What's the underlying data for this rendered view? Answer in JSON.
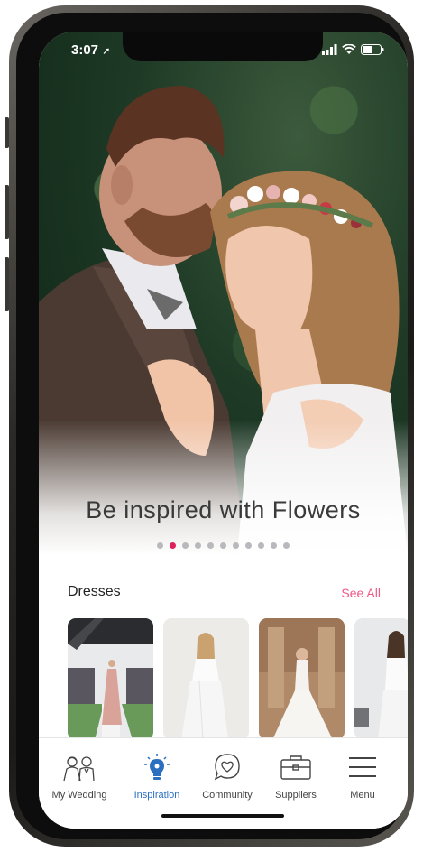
{
  "status_bar": {
    "time": "3:07"
  },
  "hero": {
    "title": "Be inspired with Flowers",
    "slide_count": 11,
    "active_slide": 1
  },
  "section": {
    "title": "Dresses",
    "see_all": "See All"
  },
  "tabs": [
    {
      "label": "My Wedding",
      "icon": "couple-icon"
    },
    {
      "label": "Inspiration",
      "icon": "lightbulb-icon"
    },
    {
      "label": "Community",
      "icon": "chat-heart-icon"
    },
    {
      "label": "Suppliers",
      "icon": "briefcase-icon"
    },
    {
      "label": "Menu",
      "icon": "hamburger-icon"
    }
  ],
  "colors": {
    "accent": "#e0205a",
    "active_tab": "#2a6fc0",
    "see_all": "#ee5a86"
  }
}
